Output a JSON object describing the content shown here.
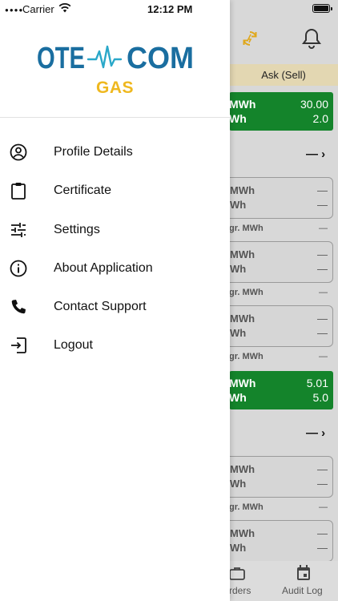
{
  "status_bar": {
    "carrier": "Carrier",
    "time": "12:12 PM"
  },
  "drawer": {
    "logo_text": "OTE COM",
    "subtitle": "GAS",
    "menu": [
      {
        "label": "Profile Details",
        "icon": "profile-circle-icon"
      },
      {
        "label": "Certificate",
        "icon": "clipboard-icon"
      },
      {
        "label": "Settings",
        "icon": "sliders-icon"
      },
      {
        "label": "About Application",
        "icon": "info-circle-icon"
      },
      {
        "label": "Contact Support",
        "icon": "phone-icon"
      },
      {
        "label": "Logout",
        "icon": "logout-icon"
      }
    ]
  },
  "background_screen": {
    "ask_header": "Ask (Sell)",
    "green_card_1": {
      "unit_top": "MWh",
      "value_top": "30.00",
      "unit_bottom": "Wh",
      "value_bottom": "2.0"
    },
    "row_arrow_1": "— ›",
    "cards": [
      {
        "unit_top": "MWh",
        "value_top": "—",
        "unit_bottom": "Wh",
        "value_bottom": "—",
        "sub": "gr. MWh",
        "sub_value": "—"
      },
      {
        "unit_top": "MWh",
        "value_top": "—",
        "unit_bottom": "Wh",
        "value_bottom": "—",
        "sub": "gr. MWh",
        "sub_value": "—"
      },
      {
        "unit_top": "MWh",
        "value_top": "—",
        "unit_bottom": "Wh",
        "value_bottom": "—",
        "sub": "gr. MWh",
        "sub_value": "—"
      }
    ],
    "green_card_2": {
      "unit_top": "MWh",
      "value_top": "5.01",
      "unit_bottom": "Wh",
      "value_bottom": "5.0"
    },
    "row_arrow_2": "— ›",
    "cards_2": [
      {
        "unit_top": "MWh",
        "value_top": "—",
        "unit_bottom": "Wh",
        "value_bottom": "—",
        "sub": "gr. MWh",
        "sub_value": "—"
      },
      {
        "unit_top": "MWh",
        "value_top": "—",
        "unit_bottom": "Wh",
        "value_bottom": "—"
      }
    ],
    "tabs": [
      {
        "label": "rders",
        "icon": "briefcase-icon"
      },
      {
        "label": "Audit Log",
        "icon": "calendar-icon"
      }
    ]
  },
  "colors": {
    "brand_blue": "#1a6ea0",
    "brand_teal": "#2aa8c9",
    "gas_yellow": "#efb81f",
    "green": "#14842b"
  }
}
